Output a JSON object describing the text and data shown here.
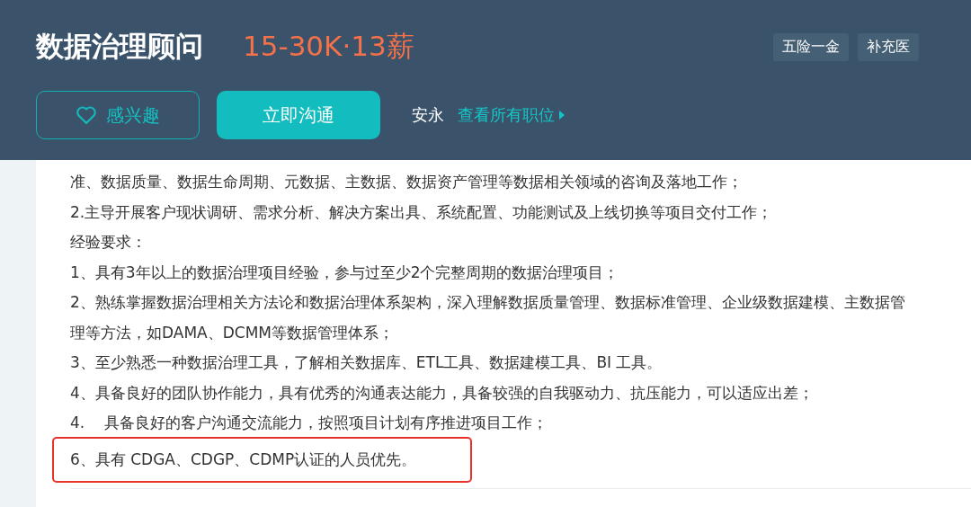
{
  "header": {
    "title": "数据治理顾问",
    "salary": "15-30K·13薪",
    "tags": [
      "五险一金",
      "补充医"
    ],
    "interest_button": "感兴趣",
    "chat_button": "立即沟通",
    "recruiter": "安永",
    "all_jobs_link": "查看所有职位"
  },
  "description": [
    {
      "text": "准、数据质量、数据生命周期、元数据、主数据、数据资产管理等数据相关领域的咨询及落地工作；",
      "highlighted": false
    },
    {
      "text": "2.主导开展客户现状调研、需求分析、解决方案出具、系统配置、功能测试及上线切换等项目交付工作；",
      "highlighted": false
    },
    {
      "text": "经验要求：",
      "highlighted": false
    },
    {
      "text": "1、具有3年以上的数据治理项目经验，参与过至少2个完整周期的数据治理项目；",
      "highlighted": false
    },
    {
      "text": "2、熟练掌握数据治理相关方法论和数据治理体系架构，深入理解数据质量管理、数据标准管理、企业级数据建模、主数据管",
      "highlighted": false
    },
    {
      "text": "理等方法，如DAMA、DCMM等数据管理体系；",
      "highlighted": false
    },
    {
      "text": "3、至少熟悉一种数据治理工具，了解相关数据库、ETL工具、数据建模工具、BI 工具。",
      "highlighted": false
    },
    {
      "text": "4、具备良好的团队协作能力，具有优秀的沟通表达能力，具备较强的自我驱动力、抗压能力，可以适应出差；",
      "highlighted": false
    },
    {
      "text": "4.    具备良好的客户沟通交流能力，按照项目计划有序推进项目工作；",
      "highlighted": false
    },
    {
      "text": "6、具有 CDGA、CDGP、CDMP认证的人员优先。",
      "highlighted": true
    }
  ]
}
